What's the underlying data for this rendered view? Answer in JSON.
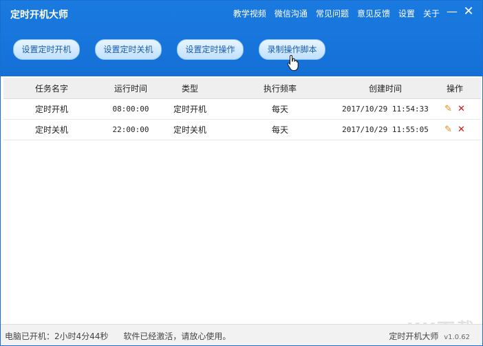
{
  "app": {
    "title": "定时开机大师"
  },
  "topnav": [
    "教学视频",
    "微信沟通",
    "常见问题",
    "意见反馈",
    "设置",
    "关于"
  ],
  "window_controls": {
    "minimize": "—",
    "close": "✕"
  },
  "toolbar": {
    "buttons": [
      "设置定时开机",
      "设置定时关机",
      "设置定时操作",
      "录制操作脚本"
    ]
  },
  "table": {
    "headers": [
      "任务名字",
      "运行时间",
      "类型",
      "执行频率",
      "创建时间",
      "操作"
    ],
    "rows": [
      {
        "name": "定时开机",
        "time": "08:00:00",
        "type": "定时开机",
        "freq": "每天",
        "created": "2017/10/29 11:54:33"
      },
      {
        "name": "定时关机",
        "time": "22:00:00",
        "type": "定时关机",
        "freq": "每天",
        "created": "2017/10/29 11:55:05"
      }
    ],
    "icons": {
      "edit": "pencil-icon",
      "delete": "close-icon"
    }
  },
  "status": {
    "uptime": "电脑已开机：2小时4分44秒",
    "activation": "软件已经激活，请放心使用。",
    "app_name": "定时开机大师",
    "version": "v1.0.62"
  },
  "watermark": "KK下载",
  "colors": {
    "header": "#1570d6",
    "button_text": "#1b5da8",
    "delete": "#e01010",
    "edit": "#d98a16"
  }
}
